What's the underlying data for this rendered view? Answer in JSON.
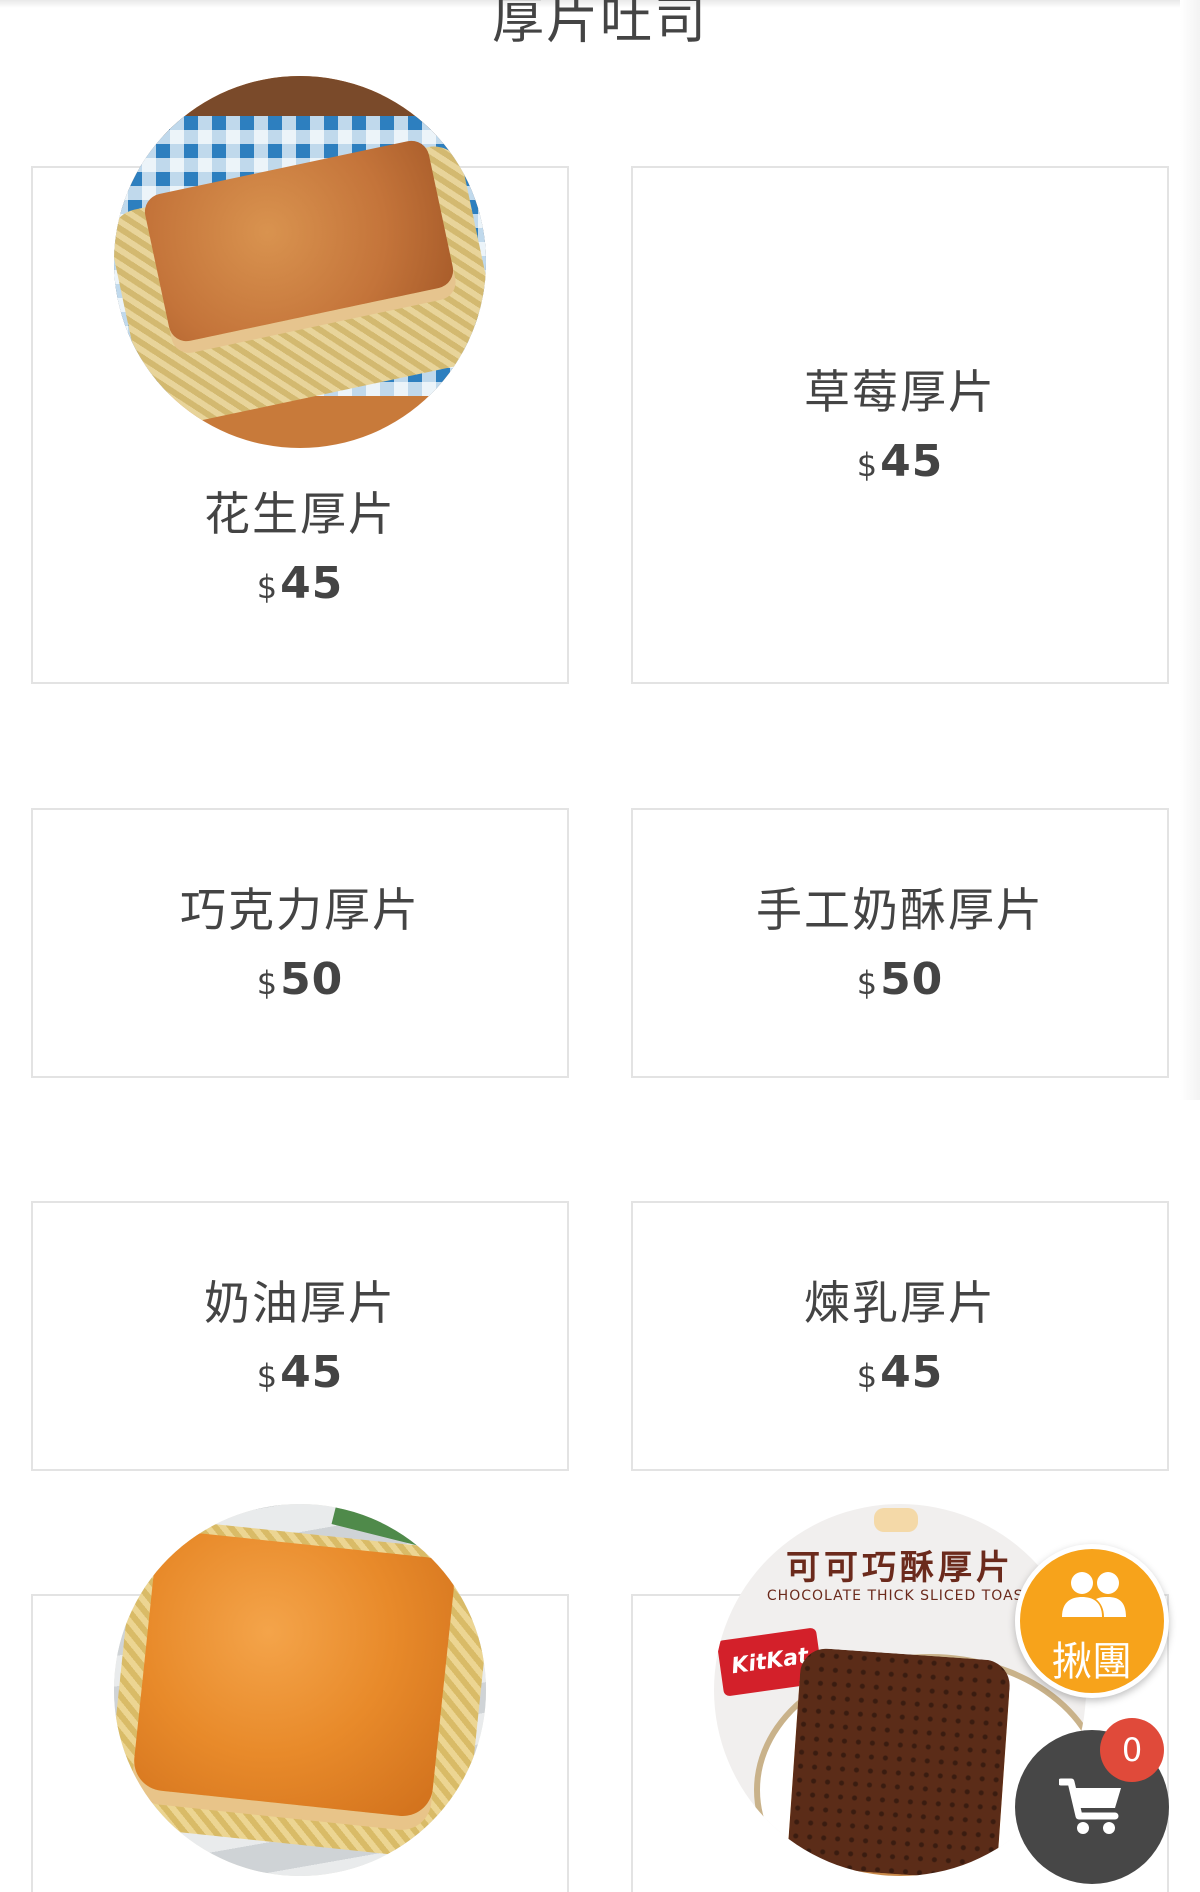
{
  "section": {
    "title": "厚片吐司"
  },
  "currency_symbol": "$",
  "products": [
    {
      "name": "花生厚片",
      "price": "45",
      "image": "peanut-toast"
    },
    {
      "name": "草莓厚片",
      "price": "45"
    },
    {
      "name": "巧克力厚片",
      "price": "50"
    },
    {
      "name": "手工奶酥厚片",
      "price": "50"
    },
    {
      "name": "奶油厚片",
      "price": "45"
    },
    {
      "name": "煉乳厚片",
      "price": "45"
    },
    {
      "image": "butter-toast"
    },
    {
      "image": "cocoa-crisp-toast",
      "image_text": "可可巧酥厚片",
      "image_subtext": "CHOCOLATE THICK SLICED TOAST",
      "image_brand": "KitKat"
    }
  ],
  "floating": {
    "group_label": "揪團",
    "cart_count": "0"
  },
  "colors": {
    "accent_orange": "#f7a31b",
    "cart_dark": "#474747",
    "badge_red": "#e04a3a",
    "card_border": "#e3e3e3"
  },
  "icons": {
    "group": "group-people-icon",
    "cart": "shopping-cart-icon"
  }
}
